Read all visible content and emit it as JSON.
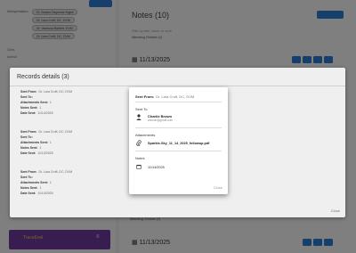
{
  "background": {
    "interpretation_label": "Interpretation",
    "tags": [
      "Dr. Bowen Dispense Mgmt",
      "Dr. Lara Croft, DC, DVM",
      "Dr. Vanessa Bartlett, DVM",
      "Dr. Lara Croft, DC, DVM"
    ],
    "side_items": [
      "Clinic",
      "Animal"
    ],
    "purple_card_title": "TraceEval",
    "notes_title": "Notes (10)",
    "notes_hint": "Filter by date, name, or more",
    "notes_line": "Attending Clinician (4)",
    "date_rows": [
      "11/13/2025",
      "11/13/2025"
    ],
    "bottom_bar": "Attending Clinician (2)"
  },
  "records": {
    "title": "Records details (3)",
    "items": [
      {
        "sent_from_label": "Sent From:",
        "sent_from": "Dr. Lara Croft, DC, DVM",
        "sent_to_label": "Sent To:",
        "sent_to": "",
        "attachments_label": "Attachments Sent:",
        "attachments": "1",
        "notes_label": "Notes Sent:",
        "notes": "1",
        "date_label": "Date Sent:",
        "date": "11/14/2025"
      },
      {
        "sent_from_label": "Sent From:",
        "sent_from": "Dr. Lara Croft, DC, DVM",
        "sent_to_label": "Sent To:",
        "sent_to": "",
        "attachments_label": "Attachments Sent:",
        "attachments": "1",
        "notes_label": "Notes Sent:",
        "notes": "1",
        "date_label": "Date Sent:",
        "date": "11/13/2025"
      },
      {
        "sent_from_label": "Sent From:",
        "sent_from": "Dr. Lara Croft, DC, DVM",
        "sent_to_label": "Sent To:",
        "sent_to": "",
        "attachments_label": "Attachments Sent:",
        "attachments": "1",
        "notes_label": "Notes Sent:",
        "notes": "1",
        "date_label": "Date Sent:",
        "date": "11/13/2025"
      }
    ],
    "close_label": "Close"
  },
  "modal": {
    "sent_from_label": "Sent From:",
    "sent_from": "Dr. Lara Croft, DC, DVM",
    "sent_to_label": "Sent To",
    "recipient_name": "Charlie Brown",
    "recipient_email": "cbrown@gmail.com",
    "attachments_label": "Attachments",
    "file_name": "Sparkle-Sky_11_14_2025_followup.pdf",
    "notes_label": "Notes",
    "note_date": "11/14/2025",
    "close_label": "Close"
  }
}
